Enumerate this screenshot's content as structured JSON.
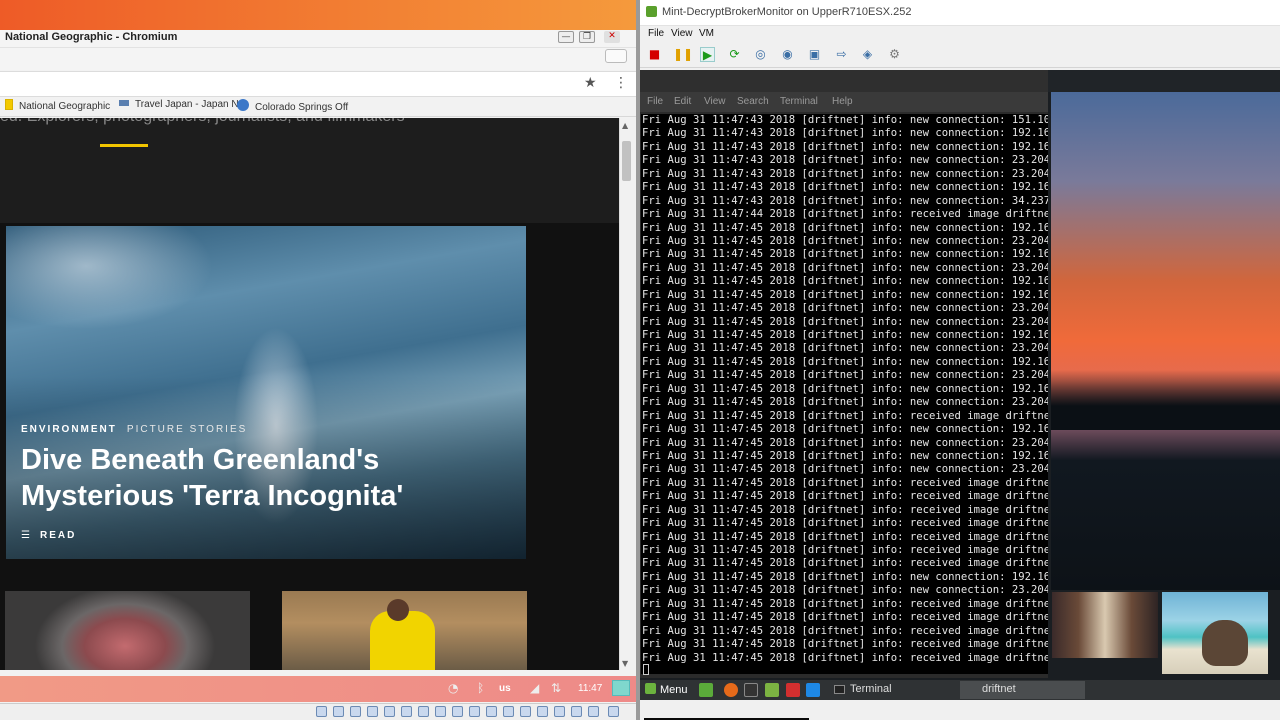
{
  "left_window": {
    "title": "National Geographic - Chromium",
    "min_label": "—",
    "max_label": "❐",
    "close_label": "✕",
    "star_glyph": "★",
    "menu_glyph": "⋮",
    "bookmarks": [
      {
        "label": "National Geographic",
        "color": "#f3c900"
      },
      {
        "label": "Travel Japan - Japan N",
        "color": "#5a7fb0"
      },
      {
        "label": "Colorado Springs Off",
        "color": "#3c78c8"
      }
    ],
    "page": {
      "cut_text": "ed. Explorers, photographers, journalists, and filmmakers",
      "hero": {
        "tag1": "ENVIRONMENT",
        "tag2": "PICTURE STORIES",
        "title": "Dive Beneath Greenland's Mysterious 'Terra Incognita'",
        "read_label": "READ",
        "read_glyph": "☰"
      }
    },
    "tray": {
      "keyboard": "us",
      "clock": "11:47"
    }
  },
  "right_window": {
    "title": "Mint-DecryptBrokerMonitor on UpperR710ESX.252",
    "menu": [
      "File",
      "View",
      "VM"
    ],
    "terminal": {
      "menu": [
        "File",
        "Edit",
        "View",
        "Search",
        "Terminal",
        "Help"
      ],
      "lines": [
        "Fri Aug 31 11:47:43 2018 [driftnet] info: new connection: 151.101",
        "Fri Aug 31 11:47:43 2018 [driftnet] info: new connection: 192.168",
        "Fri Aug 31 11:47:43 2018 [driftnet] info: new connection: 192.168",
        "Fri Aug 31 11:47:43 2018 [driftnet] info: new connection: 23.204",
        "Fri Aug 31 11:47:43 2018 [driftnet] info: new connection: 23.204",
        "Fri Aug 31 11:47:43 2018 [driftnet] info: new connection: 192.168",
        "Fri Aug 31 11:47:43 2018 [driftnet] info: new connection: 34.237",
        "Fri Aug 31 11:47:44 2018 [driftnet] info: received image driftnet",
        "Fri Aug 31 11:47:45 2018 [driftnet] info: new connection: 192.168",
        "Fri Aug 31 11:47:45 2018 [driftnet] info: new connection: 23.204",
        "Fri Aug 31 11:47:45 2018 [driftnet] info: new connection: 192.168",
        "Fri Aug 31 11:47:45 2018 [driftnet] info: new connection: 23.204",
        "Fri Aug 31 11:47:45 2018 [driftnet] info: new connection: 192.168",
        "Fri Aug 31 11:47:45 2018 [driftnet] info: new connection: 192.168",
        "Fri Aug 31 11:47:45 2018 [driftnet] info: new connection: 23.204",
        "Fri Aug 31 11:47:45 2018 [driftnet] info: new connection: 23.204",
        "Fri Aug 31 11:47:45 2018 [driftnet] info: new connection: 192.168",
        "Fri Aug 31 11:47:45 2018 [driftnet] info: new connection: 23.204",
        "Fri Aug 31 11:47:45 2018 [driftnet] info: new connection: 192.168",
        "Fri Aug 31 11:47:45 2018 [driftnet] info: new connection: 23.204",
        "Fri Aug 31 11:47:45 2018 [driftnet] info: new connection: 192.168",
        "Fri Aug 31 11:47:45 2018 [driftnet] info: new connection: 23.204",
        "Fri Aug 31 11:47:45 2018 [driftnet] info: received image driftnet",
        "Fri Aug 31 11:47:45 2018 [driftnet] info: new connection: 192.168",
        "Fri Aug 31 11:47:45 2018 [driftnet] info: new connection: 23.204",
        "Fri Aug 31 11:47:45 2018 [driftnet] info: new connection: 192.168",
        "Fri Aug 31 11:47:45 2018 [driftnet] info: new connection: 23.204",
        "Fri Aug 31 11:47:45 2018 [driftnet] info: received image driftnet",
        "Fri Aug 31 11:47:45 2018 [driftnet] info: received image driftnet",
        "Fri Aug 31 11:47:45 2018 [driftnet] info: received image driftnet",
        "Fri Aug 31 11:47:45 2018 [driftnet] info: received image driftnet",
        "Fri Aug 31 11:47:45 2018 [driftnet] info: received image driftnet",
        "Fri Aug 31 11:47:45 2018 [driftnet] info: received image driftnet",
        "Fri Aug 31 11:47:45 2018 [driftnet] info: received image driftnet",
        "Fri Aug 31 11:47:45 2018 [driftnet] info: new connection: 192.168",
        "Fri Aug 31 11:47:45 2018 [driftnet] info: new connection: 23.204",
        "Fri Aug 31 11:47:45 2018 [driftnet] info: received image driftnet",
        "Fri Aug 31 11:47:45 2018 [driftnet] info: received image driftnet",
        "Fri Aug 31 11:47:45 2018 [driftnet] info: received image driftnet",
        "Fri Aug 31 11:47:45 2018 [driftnet] info: received image driftnet",
        "Fri Aug 31 11:47:45 2018 [driftnet] info: received image driftnet"
      ]
    },
    "panel": {
      "menu_label": "Menu",
      "tasks": [
        "Terminal",
        "driftnet"
      ]
    }
  },
  "icons": {
    "stop": "stop-icon",
    "pause": "pause-icon",
    "play": "play-icon",
    "reset": "reset-icon"
  },
  "colors": {
    "ngeo_yellow": "#f2c500",
    "chromium_orange": "#ee5b27",
    "terminal_bg": "#000000",
    "mint_green": "#6cb33e"
  }
}
